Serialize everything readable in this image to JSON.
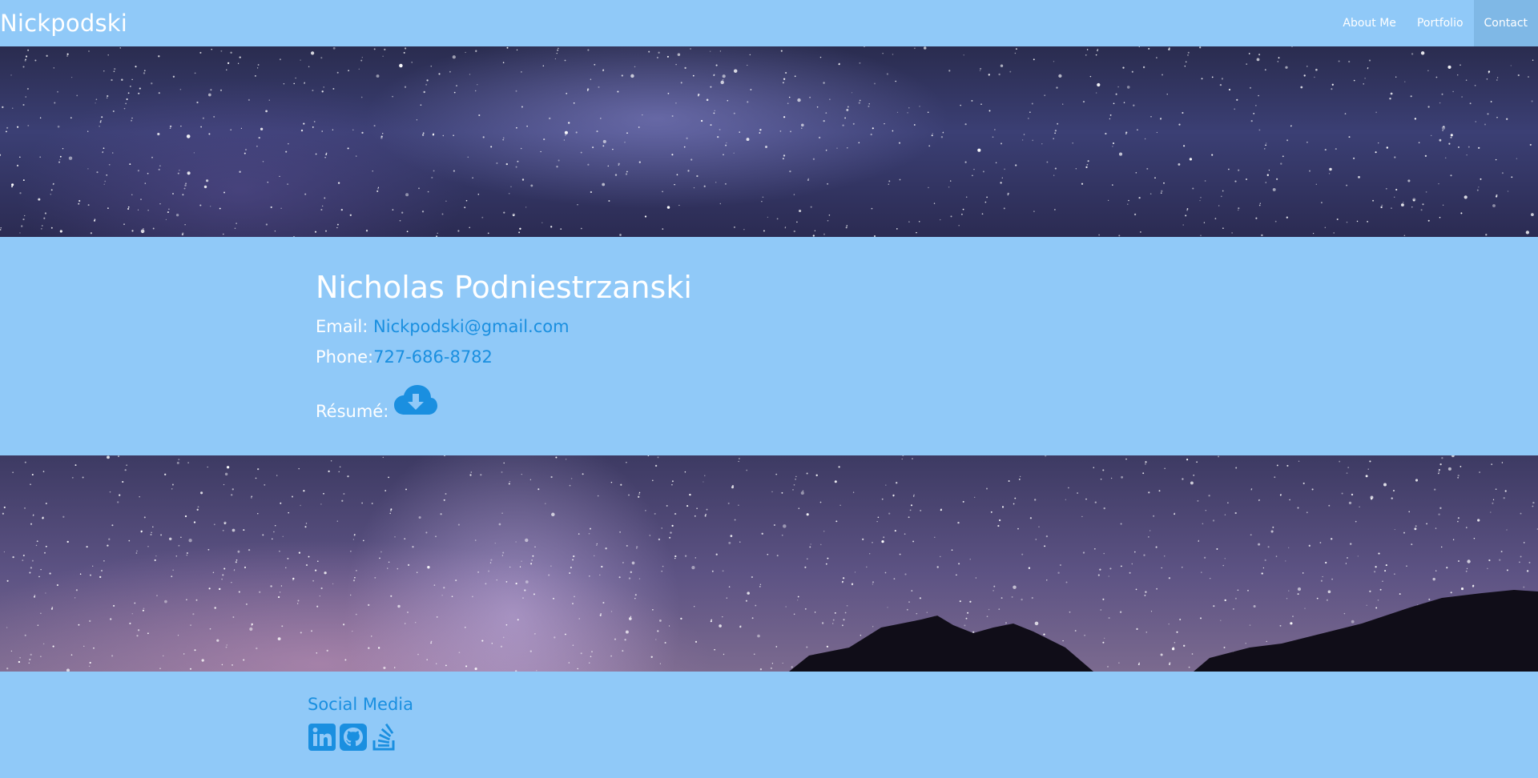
{
  "nav": {
    "brand": "Nickpodski",
    "links": [
      {
        "label": "About Me"
      },
      {
        "label": "Portfolio"
      },
      {
        "label": "Contact",
        "active": true
      }
    ]
  },
  "contact": {
    "name": "Nicholas Podniestrzanski",
    "email_label": "Email:",
    "email_value": "Nickpodski@gmail.com",
    "phone_label": "Phone:",
    "phone_value": "727-686-8782",
    "resume_label": "Résumé:",
    "resume_icon": "cloud-download-icon"
  },
  "footer": {
    "title": "Social Media",
    "icons": [
      "linkedin-icon",
      "github-icon",
      "stackoverflow-icon"
    ]
  },
  "colors": {
    "background": "#90c9f8",
    "accent": "#1a8fe0",
    "active_nav": "#7fb8e6"
  }
}
